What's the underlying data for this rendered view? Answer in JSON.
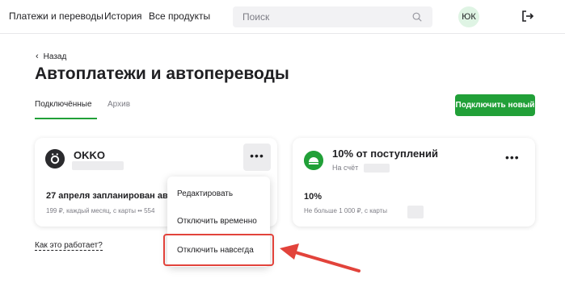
{
  "nav": {
    "links": [
      "Платежи и переводы",
      "История",
      "Все продукты"
    ],
    "search_placeholder": "Поиск",
    "avatar_initials": "ЮК"
  },
  "page": {
    "back_label": "Назад",
    "title": "Автоплатежи и автопереводы",
    "tabs": [
      "Подключённые",
      "Архив"
    ],
    "connect_button": "Подключить новый",
    "how_it_works": "Как это работает?"
  },
  "cards": [
    {
      "name": "OKKO",
      "main": "27 апреля запланирован ав",
      "sub": "199 ₽, каждый месяц, с карты •• 554"
    },
    {
      "name": "10% от поступлений",
      "to": "На счёт",
      "percent": "10%",
      "limit": "Не больше 1 000 ₽, с карты"
    }
  ],
  "menu": {
    "items": [
      "Редактировать",
      "Отключить временно",
      "Отключить навсегда"
    ]
  },
  "colors": {
    "accent": "#21a038",
    "highlight": "#e2433b"
  }
}
